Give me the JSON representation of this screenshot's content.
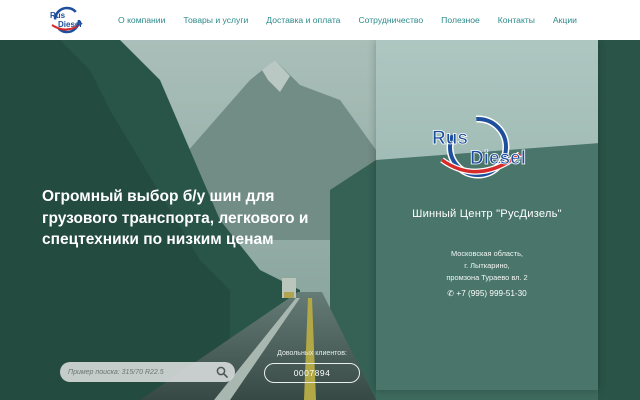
{
  "brand": {
    "logo_word1": "Rus",
    "logo_word2": "Diesel",
    "colors": {
      "accent": "#2c8a8a",
      "logo_blue": "#1d4f9c",
      "logo_red": "#d62b2b"
    }
  },
  "nav": {
    "items": [
      {
        "label": "О компании"
      },
      {
        "label": "Товары и услуги"
      },
      {
        "label": "Доставка и оплата"
      },
      {
        "label": "Сотрудничество"
      },
      {
        "label": "Полезное"
      },
      {
        "label": "Контакты"
      },
      {
        "label": "Акции"
      }
    ]
  },
  "hero": {
    "headline_line1": "Огромный выбор б/у шин для",
    "headline_line2": "грузового транспорта, легкового и",
    "headline_line3": "спецтехники по низким ценам",
    "search": {
      "placeholder": "Пример поиска: 315/70 R22.5",
      "icon": "search-icon"
    },
    "clients_label": "Довольных клиентов:",
    "clients_count": "0007894"
  },
  "card": {
    "center_name": "Шинный Центр \"РусДизель\"",
    "address_line1": "Московская область,",
    "address_line2": "г. Лыткарино,",
    "address_line3": "промзона Тураево вл. 2",
    "phone_icon": "phone-icon",
    "phone": "+7 (995) 999-51-30"
  }
}
